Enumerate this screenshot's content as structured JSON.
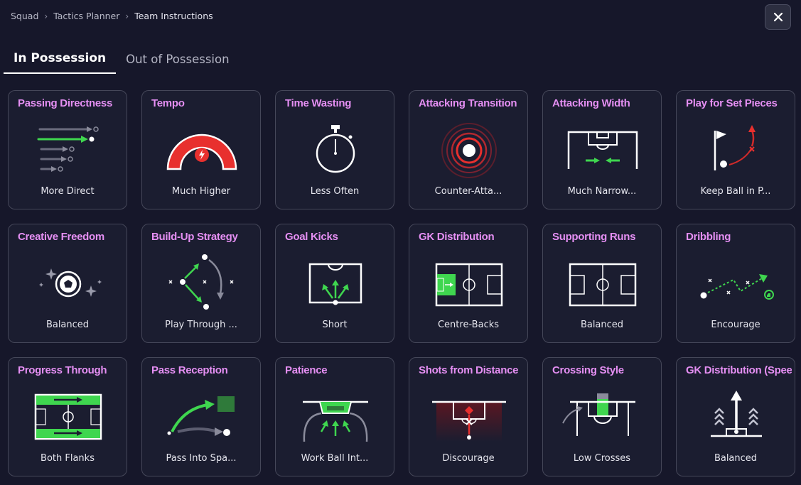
{
  "breadcrumb": {
    "items": [
      "Squad",
      "Tactics Planner",
      "Team Instructions"
    ],
    "separator": ">"
  },
  "tabs": [
    {
      "label": "In Possession",
      "active": true
    },
    {
      "label": "Out of Possession",
      "active": false
    }
  ],
  "colors": {
    "accent_title": "#e58ff3",
    "green": "#3fd64f",
    "red": "#e8302e",
    "background": "#16172a",
    "card_border": "#454759"
  },
  "instructions": [
    {
      "title": "Passing Directness",
      "value": "More Direct",
      "icon": "passing-directness-icon"
    },
    {
      "title": "Tempo",
      "value": "Much Higher",
      "icon": "tempo-gauge-icon"
    },
    {
      "title": "Time Wasting",
      "value": "Less Often",
      "icon": "stopwatch-icon"
    },
    {
      "title": "Attacking Transition",
      "value": "Counter-Atta...",
      "icon": "transition-rings-icon"
    },
    {
      "title": "Attacking Width",
      "value": "Much Narrow...",
      "icon": "attacking-width-icon"
    },
    {
      "title": "Play for Set Pieces",
      "value": "Keep Ball in P...",
      "icon": "set-pieces-icon"
    },
    {
      "title": "Creative Freedom",
      "value": "Balanced",
      "icon": "creative-freedom-icon"
    },
    {
      "title": "Build-Up Strategy",
      "value": "Play Through ...",
      "icon": "build-up-icon"
    },
    {
      "title": "Goal Kicks",
      "value": "Short",
      "icon": "goal-kicks-icon"
    },
    {
      "title": "GK Distribution",
      "value": "Centre-Backs",
      "icon": "gk-distribution-icon"
    },
    {
      "title": "Supporting Runs",
      "value": "Balanced",
      "icon": "supporting-runs-icon"
    },
    {
      "title": "Dribbling",
      "value": "Encourage",
      "icon": "dribbling-icon"
    },
    {
      "title": "Progress Through",
      "value": "Both Flanks",
      "icon": "progress-through-icon"
    },
    {
      "title": "Pass Reception",
      "value": "Pass Into Spa...",
      "icon": "pass-reception-icon"
    },
    {
      "title": "Patience",
      "value": "Work Ball Int...",
      "icon": "patience-icon"
    },
    {
      "title": "Shots from Distance",
      "value": "Discourage",
      "icon": "shots-distance-icon"
    },
    {
      "title": "Crossing Style",
      "value": "Low Crosses",
      "icon": "crossing-style-icon"
    },
    {
      "title": "GK Distribution (Speed",
      "value": "Balanced",
      "icon": "gk-speed-icon"
    }
  ]
}
